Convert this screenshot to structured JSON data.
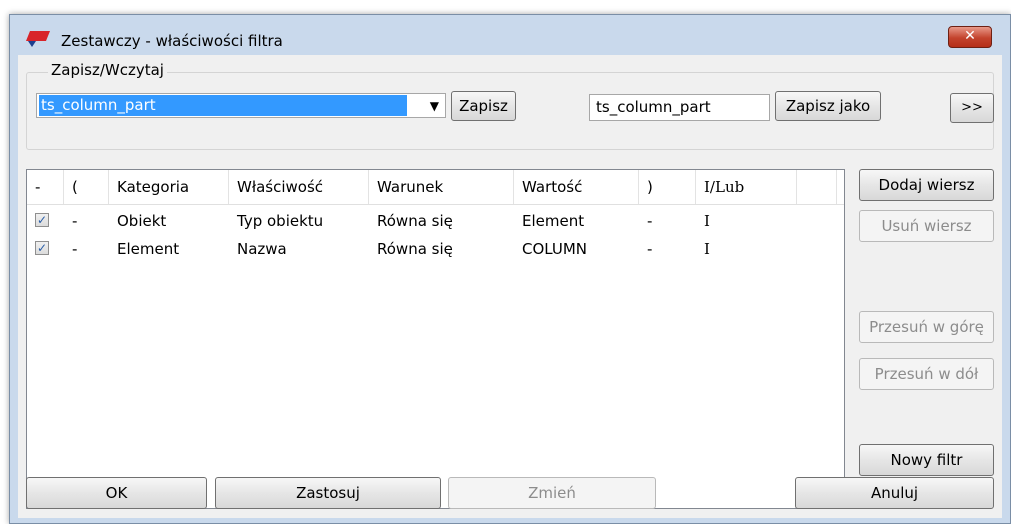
{
  "window": {
    "title": "Zestawczy - właściwości filtra",
    "close_label": "✕"
  },
  "saveload": {
    "legend": "Zapisz/Wczytaj",
    "combo_value": "ts_column_part",
    "save_label": "Zapisz",
    "name_value": "ts_column_part",
    "save_as_label": "Zapisz jako",
    "expand_label": ">>"
  },
  "table": {
    "headers": [
      "-",
      "(",
      "Kategoria",
      "Właściwość",
      "Warunek",
      "Wartość",
      ")",
      "I/Lub"
    ],
    "rows": [
      {
        "checked": true,
        "open": "-",
        "category": "Obiekt",
        "property": "Typ obiektu",
        "condition": "Równa się",
        "value": "Element",
        "close": "-",
        "logic": "I"
      },
      {
        "checked": true,
        "open": "-",
        "category": "Element",
        "property": "Nazwa",
        "condition": "Równa się",
        "value": "COLUMN",
        "close": "-",
        "logic": "I"
      }
    ]
  },
  "side_buttons": {
    "add_row": "Dodaj wiersz",
    "remove_row": "Usuń wiersz",
    "move_up": "Przesuń w górę",
    "move_down": "Przesuń w dół",
    "new_filter": "Nowy filtr"
  },
  "bottom_buttons": {
    "ok": "OK",
    "apply": "Zastosuj",
    "modify": "Zmień",
    "cancel": "Anuluj"
  },
  "colors": {
    "selection": "#3399ff",
    "close_button": "#c3432d"
  }
}
